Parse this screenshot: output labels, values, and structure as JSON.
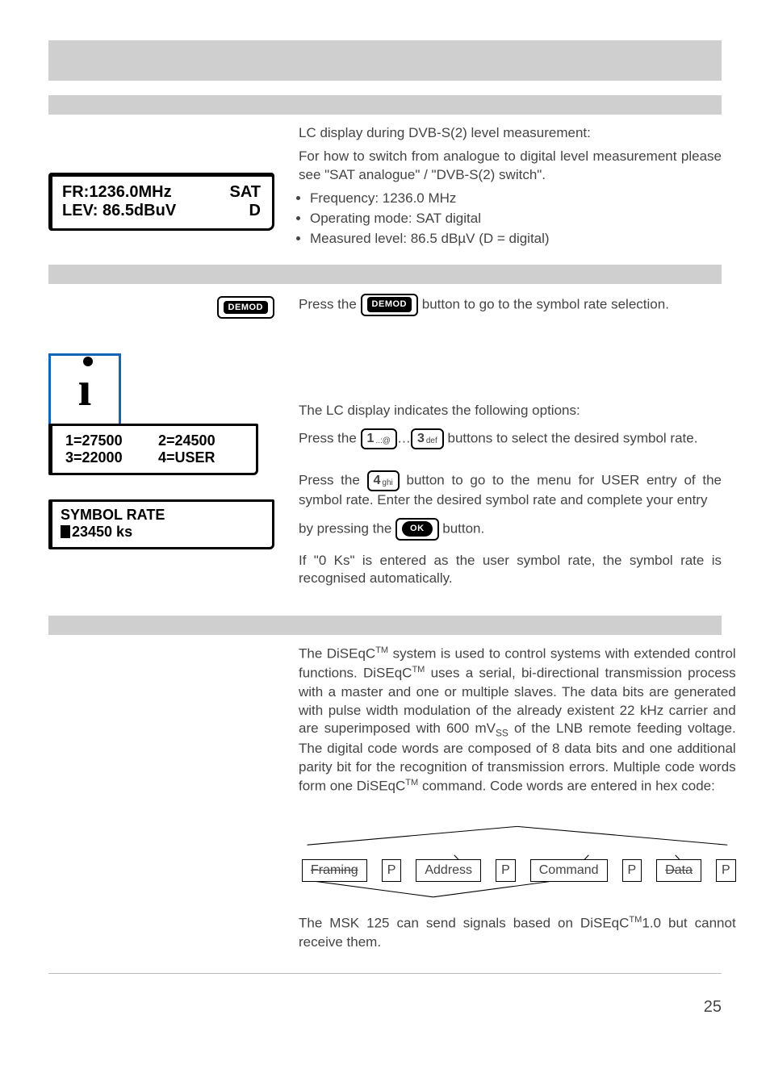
{
  "section1": {
    "intro1": "LC display during DVB-S(2) level measurement:",
    "intro2": "For how to switch from analogue to digital level measurement please see \"SAT analogue\" / \"DVB-S(2) switch\".",
    "bullets": [
      "Frequency: 1236.0 MHz",
      "Operating mode: SAT digital",
      "Measured level: 86.5 dBµV (D = digital)"
    ],
    "lcd": {
      "l1a": "FR:1236.0MHz",
      "l1b": "SAT",
      "l2a": "LEV: 86.5dBuV",
      "l2b": "D"
    }
  },
  "section2": {
    "press_pre": "Press the ",
    "press_post": " button to go to the symbol rate selection.",
    "demod_label": "DEMOD"
  },
  "section3": {
    "lc_line": "The LC display indicates the following options:",
    "press_a_pre": "Press the ",
    "press_a_mid": "…",
    "press_a_post": " buttons to select the desired symbol rate.",
    "options": {
      "r1c1": "1=27500",
      "r1c2": "2=24500",
      "r2c1": "3=22000",
      "r2c2": "4=USER"
    },
    "symbol_title": "SYMBOL RATE",
    "symbol_value": "23450 ks",
    "press_b_pre": "Press the ",
    "press_b_post": " button to go to the menu for USER entry of the symbol rate. Enter the desired symbol rate and complete your entry",
    "press_c_pre": "by pressing the ",
    "press_c_post": " button.",
    "auto": "If \"0 Ks\" is entered as the user symbol rate, the symbol rate is recognised automatically.",
    "key1_num": "1",
    "key1_sub": "..:@",
    "key3_num": "3",
    "key3_sub": "def",
    "key4_num": "4",
    "key4_sub": "ghi",
    "ok_label": "OK"
  },
  "section4": {
    "para": "The DiSEqC™ system is used to control systems with extended control functions. DiSEqC™ uses a serial, bi-directional transmission process with a master and one or multiple slaves. The data bits are generated with pulse width modulation of the already existent 22 kHz carrier and are superimposed with 600 mVSS of the LNB remote feeding voltage. The digital code words are composed of 8 data bits and one additional parity bit for the recognition of transmission errors. Multiple code words form one DiSEqC™ command. Code words are entered in hex code:",
    "diagram": {
      "framing": "Framing",
      "p": "P",
      "address": "Address",
      "command": "Command",
      "data": "Data"
    },
    "closing": "The MSK 125 can send signals based on DiSEqC™1.0 but cannot receive them."
  },
  "page_number": "25"
}
